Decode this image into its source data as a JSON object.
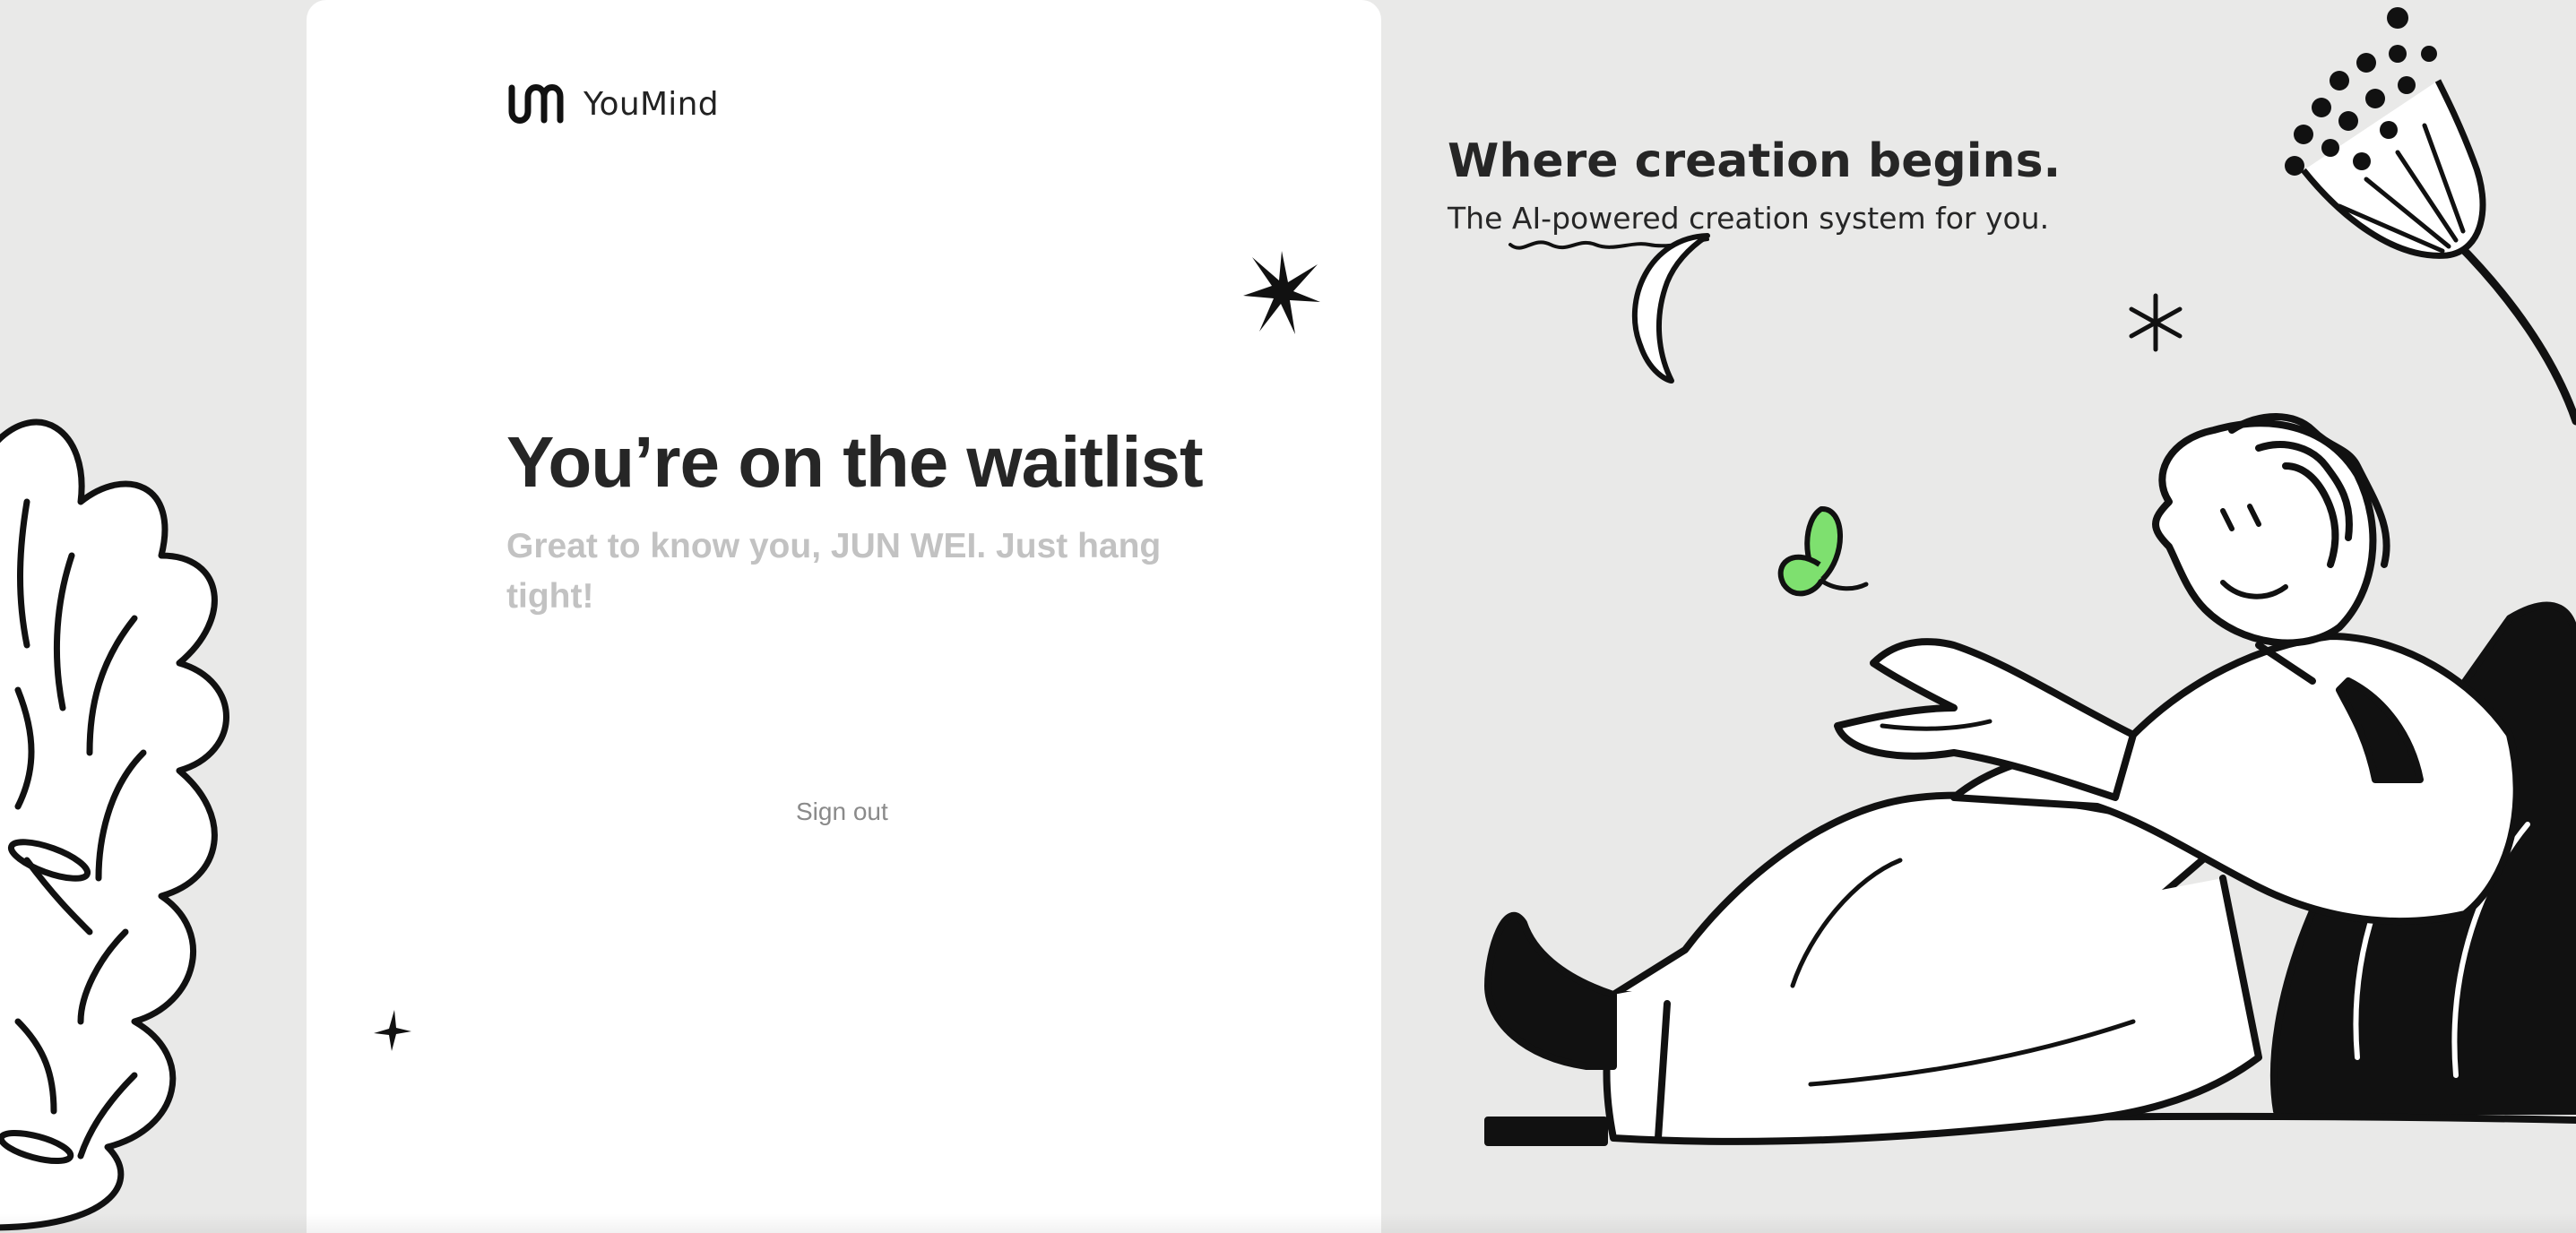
{
  "brand": {
    "name": "YouMind",
    "icon": "youmind-logo-icon"
  },
  "waitlist": {
    "title": "You’re on the waitlist",
    "subtitle": "Great to know you, JUN WEI. Just hang tight!",
    "sign_out_label": "Sign out"
  },
  "promo": {
    "headline": "Where creation begins.",
    "subheadline": "The AI-powered creation system for you."
  },
  "colors": {
    "background": "#e9e9e8",
    "card": "#ffffff",
    "text": "#262626",
    "muted": "#c2c2c2",
    "accent_green": "#7ee06f"
  }
}
